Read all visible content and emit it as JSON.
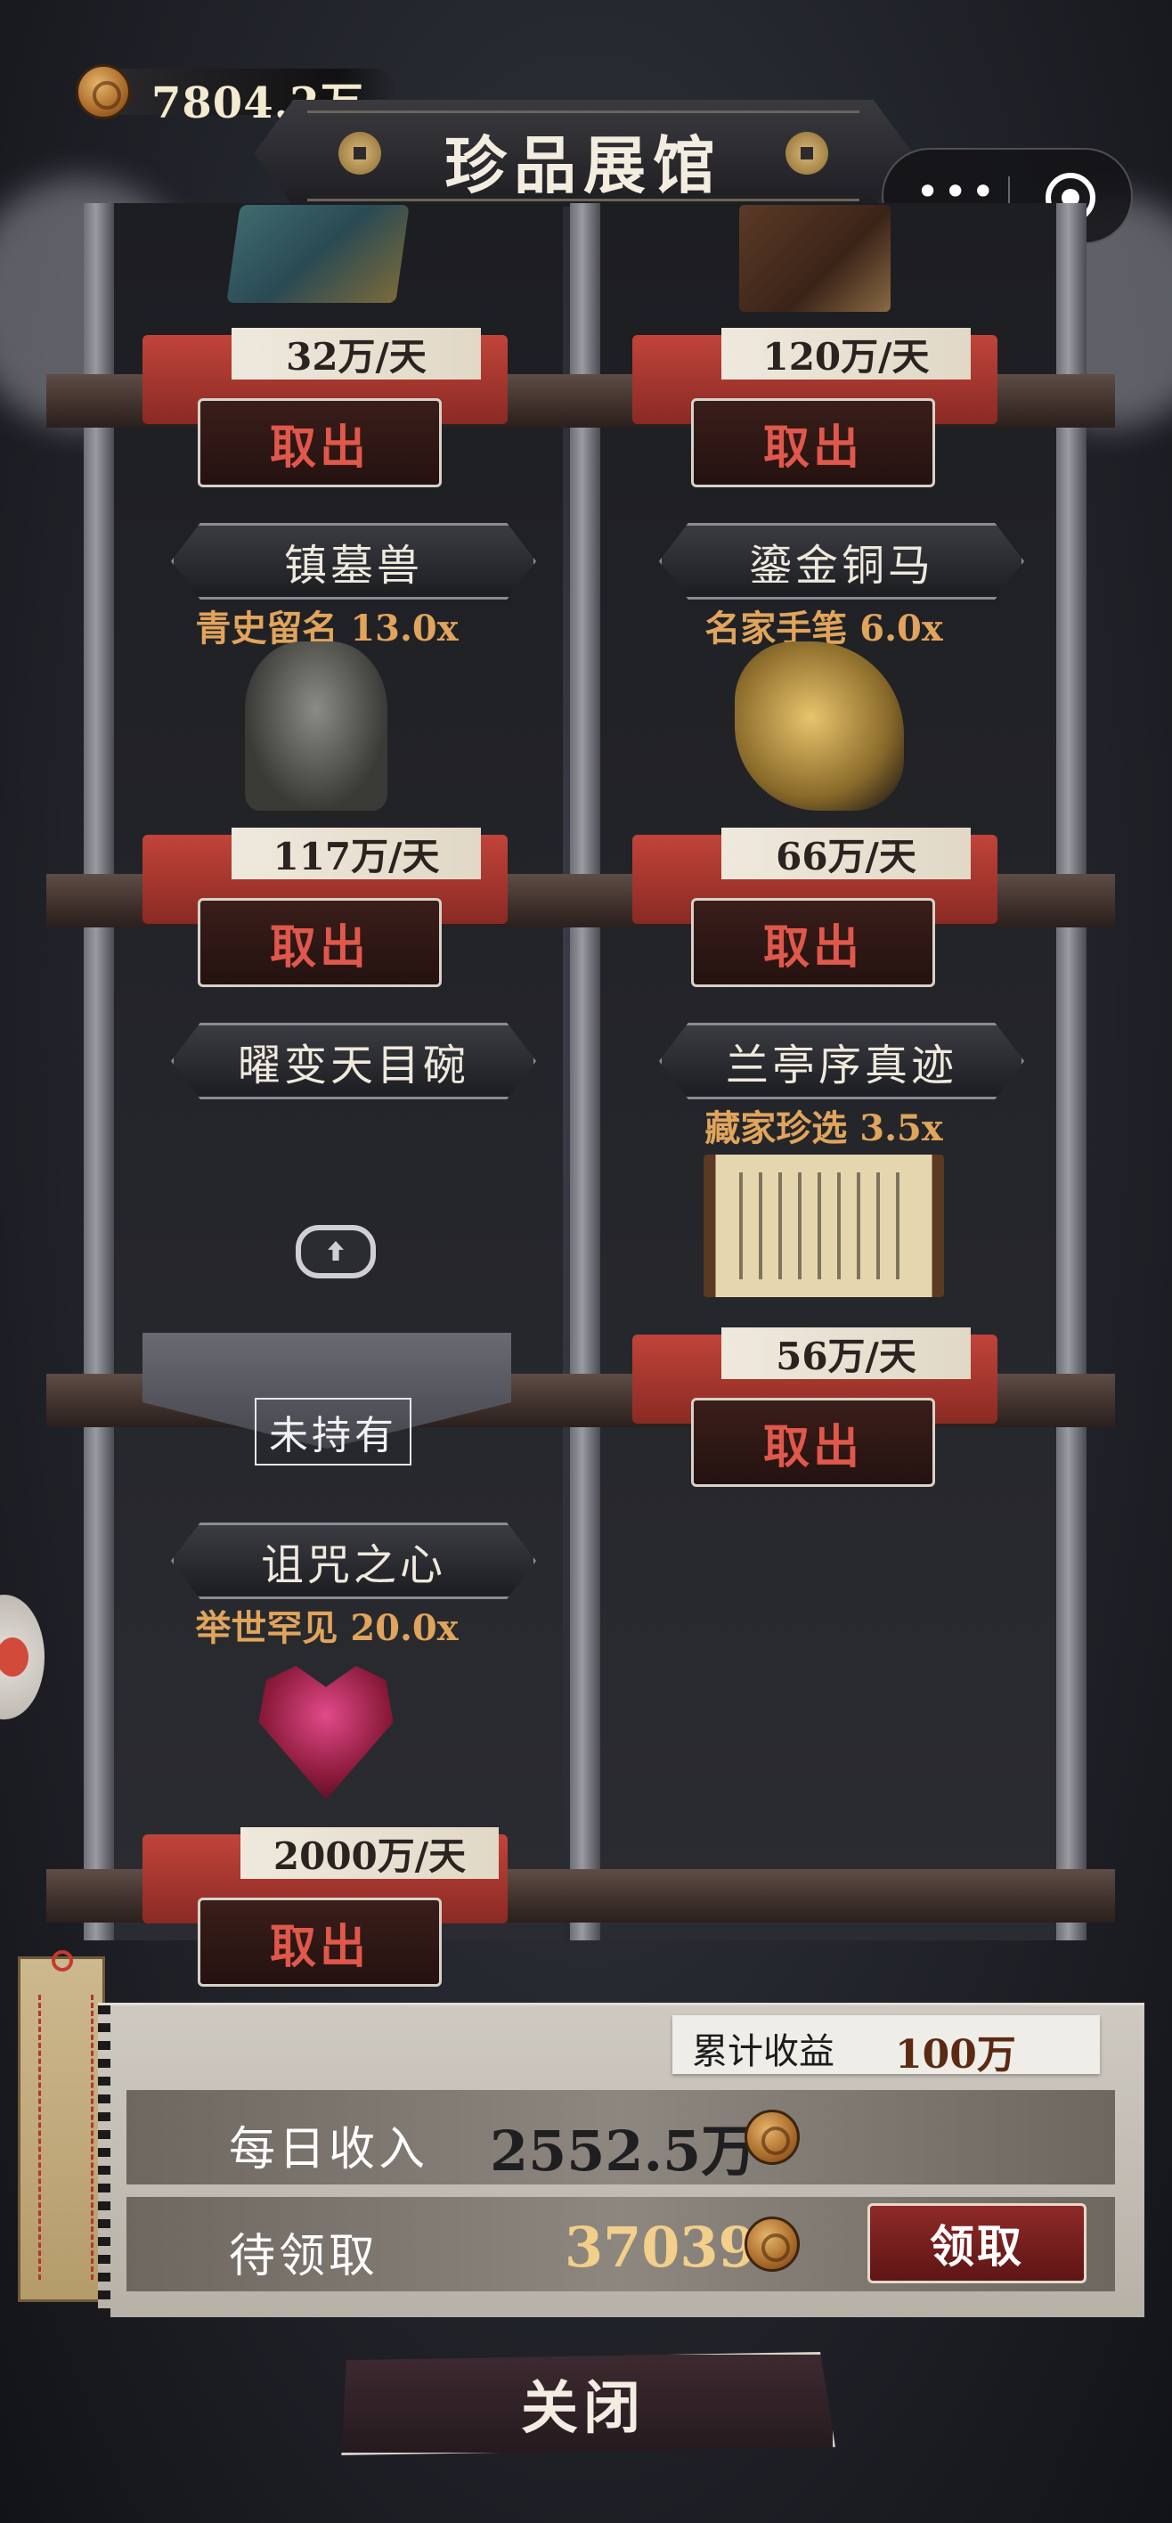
{
  "header": {
    "gold_amount": "7804.2万",
    "title": "珍品展馆"
  },
  "slots": [
    {
      "name": "",
      "bonus": "",
      "rate": "32万/天",
      "action": "取出",
      "art": "jade-tile"
    },
    {
      "name": "",
      "bonus": "",
      "rate": "120万/天",
      "action": "取出",
      "art": "ancient-book"
    },
    {
      "name": "镇墓兽",
      "bonus": "青史留名 13.0x",
      "rate": "117万/天",
      "action": "取出",
      "art": "bronze-beast"
    },
    {
      "name": "鎏金铜马",
      "bonus": "名家手笔 6.0x",
      "rate": "66万/天",
      "action": "取出",
      "art": "gilded-horse"
    },
    {
      "name": "曜变天目碗",
      "bonus": "",
      "rate": "",
      "action": "",
      "status": "未持有",
      "art": "locked"
    },
    {
      "name": "兰亭序真迹",
      "bonus": "藏家珍选 3.5x",
      "rate": "56万/天",
      "action": "取出",
      "art": "calligraphy-scroll"
    },
    {
      "name": "诅咒之心",
      "bonus": "举世罕见 20.0x",
      "rate": "2000万/天",
      "action": "取出",
      "art": "cursed-heart"
    }
  ],
  "income": {
    "cumulative_label": "累计收益",
    "cumulative_value": "100万",
    "daily_label": "每日收入",
    "daily_value": "2552.5万",
    "pending_label": "待领取",
    "pending_value": "37039",
    "claim_label": "领取"
  },
  "close_label": "关闭",
  "colors": {
    "take_text": "#e0584b",
    "bonus_text": "#e0a45c",
    "pending_value": "#f2cf8a",
    "plate_red": "#c1443a"
  }
}
